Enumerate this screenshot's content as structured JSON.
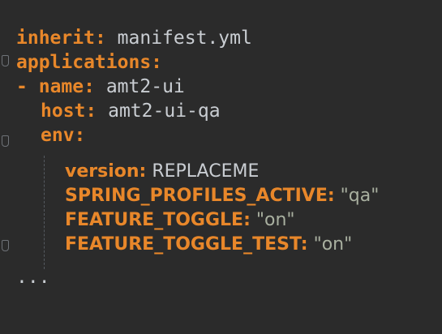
{
  "editor": {
    "language": "yaml",
    "colors": {
      "background": "#2b2b2b",
      "key": "#e8872a",
      "value": "#c9cdd2",
      "string": "#a9b0a0"
    },
    "lines": {
      "inherit_key": "inherit",
      "inherit_value": "manifest.yml",
      "applications_key": "applications",
      "dash": "-",
      "name_key": "name",
      "name_value": "amt2-ui",
      "host_key": "host",
      "host_value": "amt2-ui-qa",
      "env_key": "env",
      "version_key": "version",
      "version_value": "REPLACEME",
      "spring_key": "SPRING_PROFILES_ACTIVE",
      "spring_value": "\"qa\"",
      "toggle_key": "FEATURE_TOGGLE",
      "toggle_value": "\"on\"",
      "toggle_test_key": "FEATURE_TOGGLE_TEST",
      "toggle_test_value": "\"on\"",
      "ellipsis": "..."
    },
    "gutter_icons": [
      "fold-marker-icon",
      "fold-marker-icon",
      "fold-marker-icon"
    ]
  }
}
